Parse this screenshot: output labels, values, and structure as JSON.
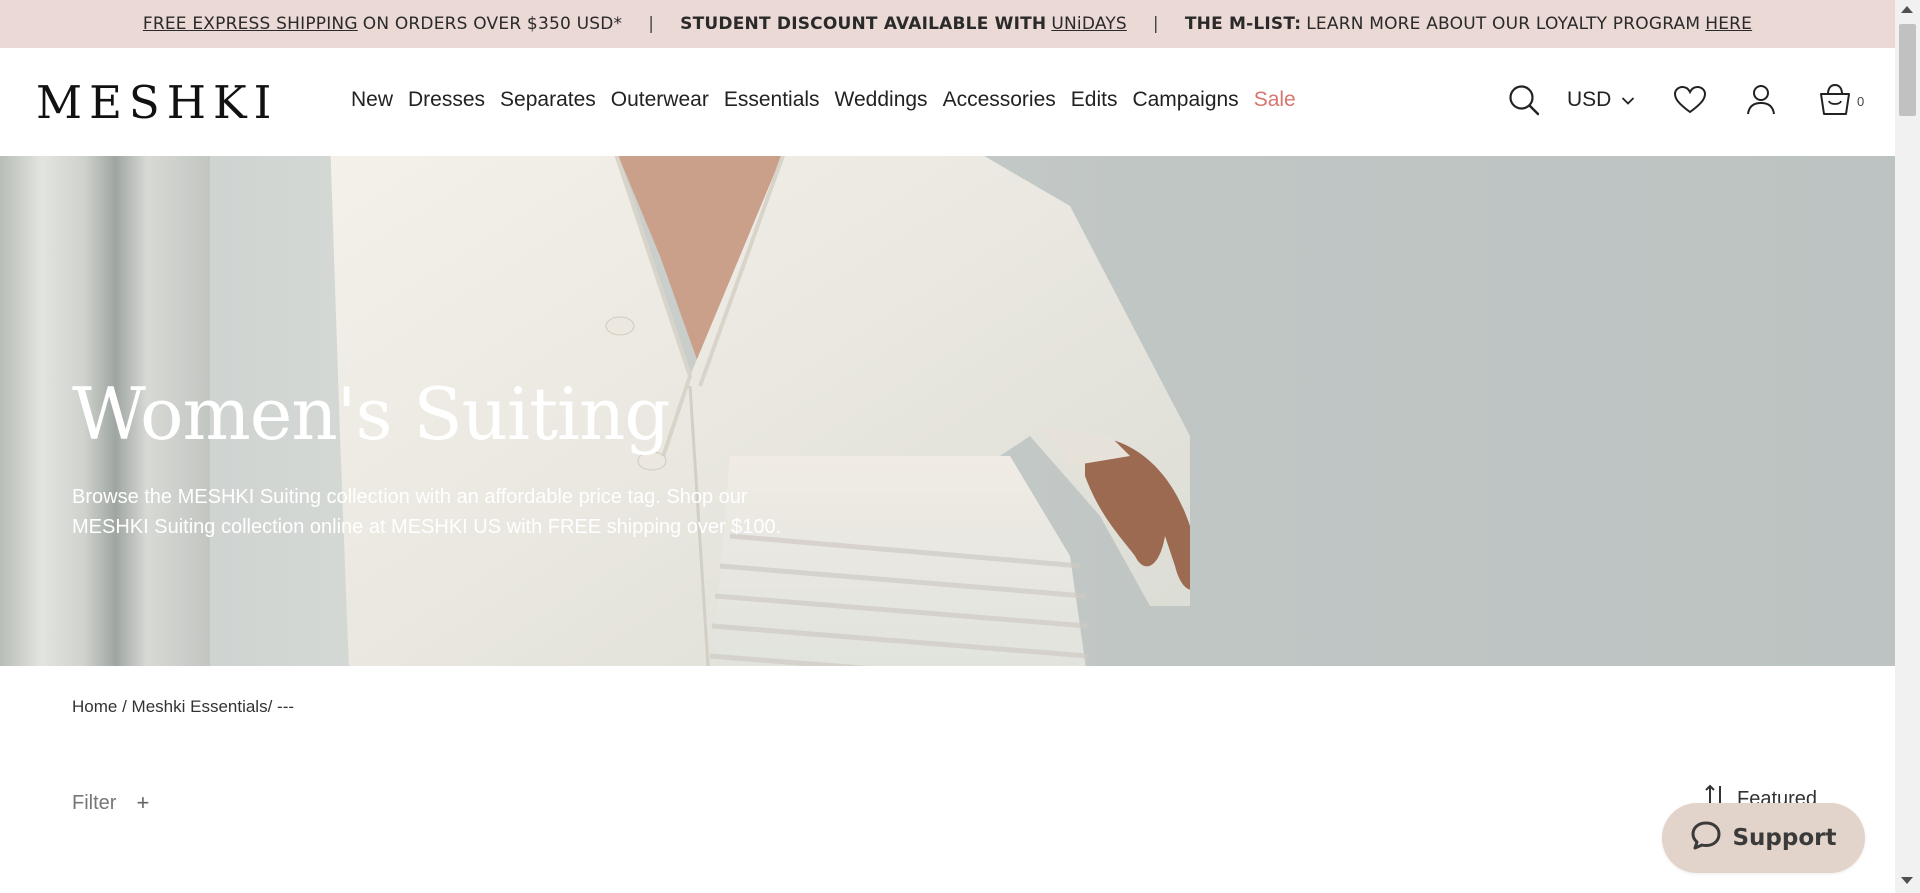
{
  "announcement": {
    "shipping_link": "FREE EXPRESS SHIPPING",
    "shipping_text": "ON ORDERS OVER $350 USD*",
    "separator": "|",
    "student_text": "STUDENT DISCOUNT AVAILABLE WITH",
    "student_link": "UNiDAYS",
    "mlist_label": "THE M-LIST:",
    "mlist_text": "LEARN MORE ABOUT OUR LOYALTY PROGRAM",
    "mlist_link": "HERE"
  },
  "header": {
    "logo": "MESHKI",
    "nav": [
      "New",
      "Dresses",
      "Separates",
      "Outerwear",
      "Essentials",
      "Weddings",
      "Accessories",
      "Edits",
      "Campaigns",
      "Sale"
    ],
    "currency": "USD",
    "cart_count": "0",
    "icons": [
      "search-icon",
      "chevron-down-icon",
      "heart-icon",
      "user-icon",
      "bag-icon"
    ]
  },
  "hero": {
    "title": "Women's Suiting",
    "description": "Browse the MESHKI Suiting collection with an affordable price tag. Shop our MESHKI Suiting collection online at MESHKI US with FREE shipping over $100."
  },
  "breadcrumb": {
    "home": "Home",
    "sep1": " / ",
    "essentials": "Meshki Essentials",
    "sep2": "/ ",
    "current": "---"
  },
  "toolbar": {
    "filter_label": "Filter",
    "filter_plus": "+",
    "sort_label": "Featured"
  },
  "support": {
    "label": "Support"
  },
  "colors": {
    "announcement_bg": "#ead9d4",
    "sale": "#d9756f",
    "support_bg": "#e3d4cb"
  }
}
